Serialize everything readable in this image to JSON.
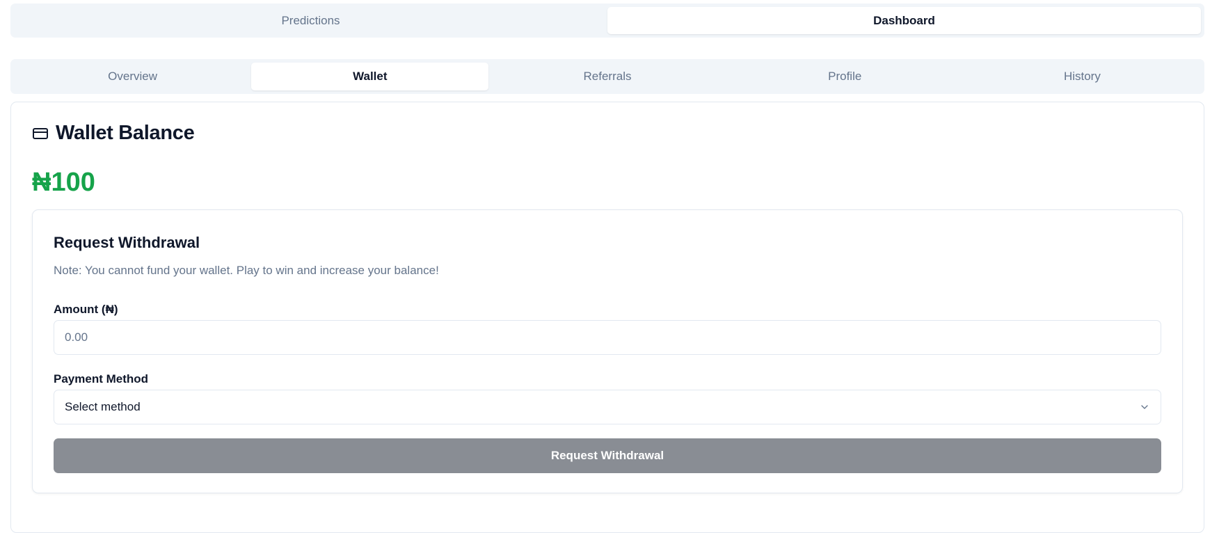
{
  "main_tabs": [
    {
      "label": "Predictions",
      "active": false
    },
    {
      "label": "Dashboard",
      "active": true
    }
  ],
  "dashboard_tabs": [
    {
      "label": "Overview",
      "active": false
    },
    {
      "label": "Wallet",
      "active": true
    },
    {
      "label": "Referrals",
      "active": false
    },
    {
      "label": "Profile",
      "active": false
    },
    {
      "label": "History",
      "active": false
    }
  ],
  "wallet": {
    "title": "Wallet Balance",
    "icon": "credit-card-icon",
    "balance": "₦100",
    "balance_color": "#16a34a"
  },
  "withdrawal": {
    "title": "Request Withdrawal",
    "note": "Note: You cannot fund your wallet. Play to win and increase your balance!",
    "amount_label": "Amount (₦)",
    "amount_placeholder": "0.00",
    "amount_value": "",
    "method_label": "Payment Method",
    "method_value": "Select method",
    "method_icon": "chevron-down-icon",
    "submit_label": "Request Withdrawal",
    "submit_color": "#898d94"
  }
}
